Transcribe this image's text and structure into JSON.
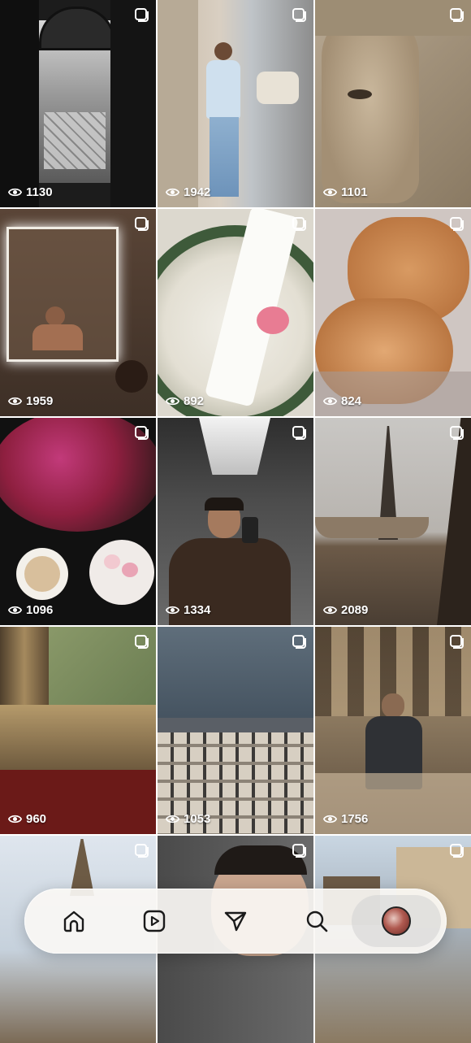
{
  "posts": [
    {
      "views": "1130",
      "scene": "dark-doorway-to-garden"
    },
    {
      "views": "1942",
      "scene": "man-walking-on-street"
    },
    {
      "views": "1101",
      "scene": "vintage-portrait-photo"
    },
    {
      "views": "1959",
      "scene": "man-in-bathtub"
    },
    {
      "views": "892",
      "scene": "napkin-with-pink-rose"
    },
    {
      "views": "824",
      "scene": "sleeping-cats"
    },
    {
      "views": "1096",
      "scene": "tulips-and-coffee"
    },
    {
      "views": "1334",
      "scene": "elevator-selfie"
    },
    {
      "views": "2089",
      "scene": "eiffel-tower-river"
    },
    {
      "views": "960",
      "scene": "gilded-frame-detail"
    },
    {
      "views": "1053",
      "scene": "parisian-building-facade"
    },
    {
      "views": "1756",
      "scene": "man-in-opera-house"
    },
    {
      "views": "",
      "scene": "eiffel-tower-trees"
    },
    {
      "views": "",
      "scene": "portrait-closeup"
    },
    {
      "views": "",
      "scene": "town-rooftops"
    }
  ],
  "nav": {
    "items": [
      {
        "name": "home-icon"
      },
      {
        "name": "reels-icon"
      },
      {
        "name": "direct-message-icon"
      },
      {
        "name": "search-icon"
      },
      {
        "name": "profile-avatar"
      }
    ]
  },
  "icons": {
    "multi_post": "multiple-photos-icon",
    "views": "eye-icon"
  },
  "colors": {
    "overlay_text": "#ffffff",
    "nav_background": "#faf7f4",
    "nav_icon": "#1a1a1a"
  }
}
